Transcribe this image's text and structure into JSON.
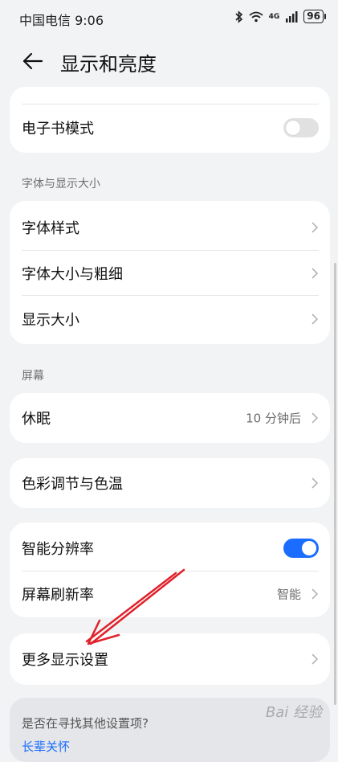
{
  "status_bar": {
    "carrier_time": "中国电信 9:06",
    "network": "4G",
    "battery": "96"
  },
  "header": {
    "title": "显示和亮度"
  },
  "cards": {
    "ebook": {
      "label": "电子书模式",
      "on": false
    },
    "font_section": "字体与显示大小",
    "font_style": "字体样式",
    "font_size": "字体大小与粗细",
    "display_size": "显示大小",
    "screen_section": "屏幕",
    "sleep": {
      "label": "休眠",
      "value": "10 分钟后"
    },
    "color": "色彩调节与色温",
    "smart_res": {
      "label": "智能分辨率",
      "on": true
    },
    "refresh": {
      "label": "屏幕刷新率",
      "value": "智能"
    },
    "more": "更多显示设置"
  },
  "help": {
    "question": "是否在寻找其他设置项?",
    "link": "长辈关怀"
  },
  "watermark": "Bai 经验",
  "colors": {
    "accent": "#1a6dff",
    "annotation_arrow": "#e0202a",
    "background": "#f1f3f5"
  }
}
